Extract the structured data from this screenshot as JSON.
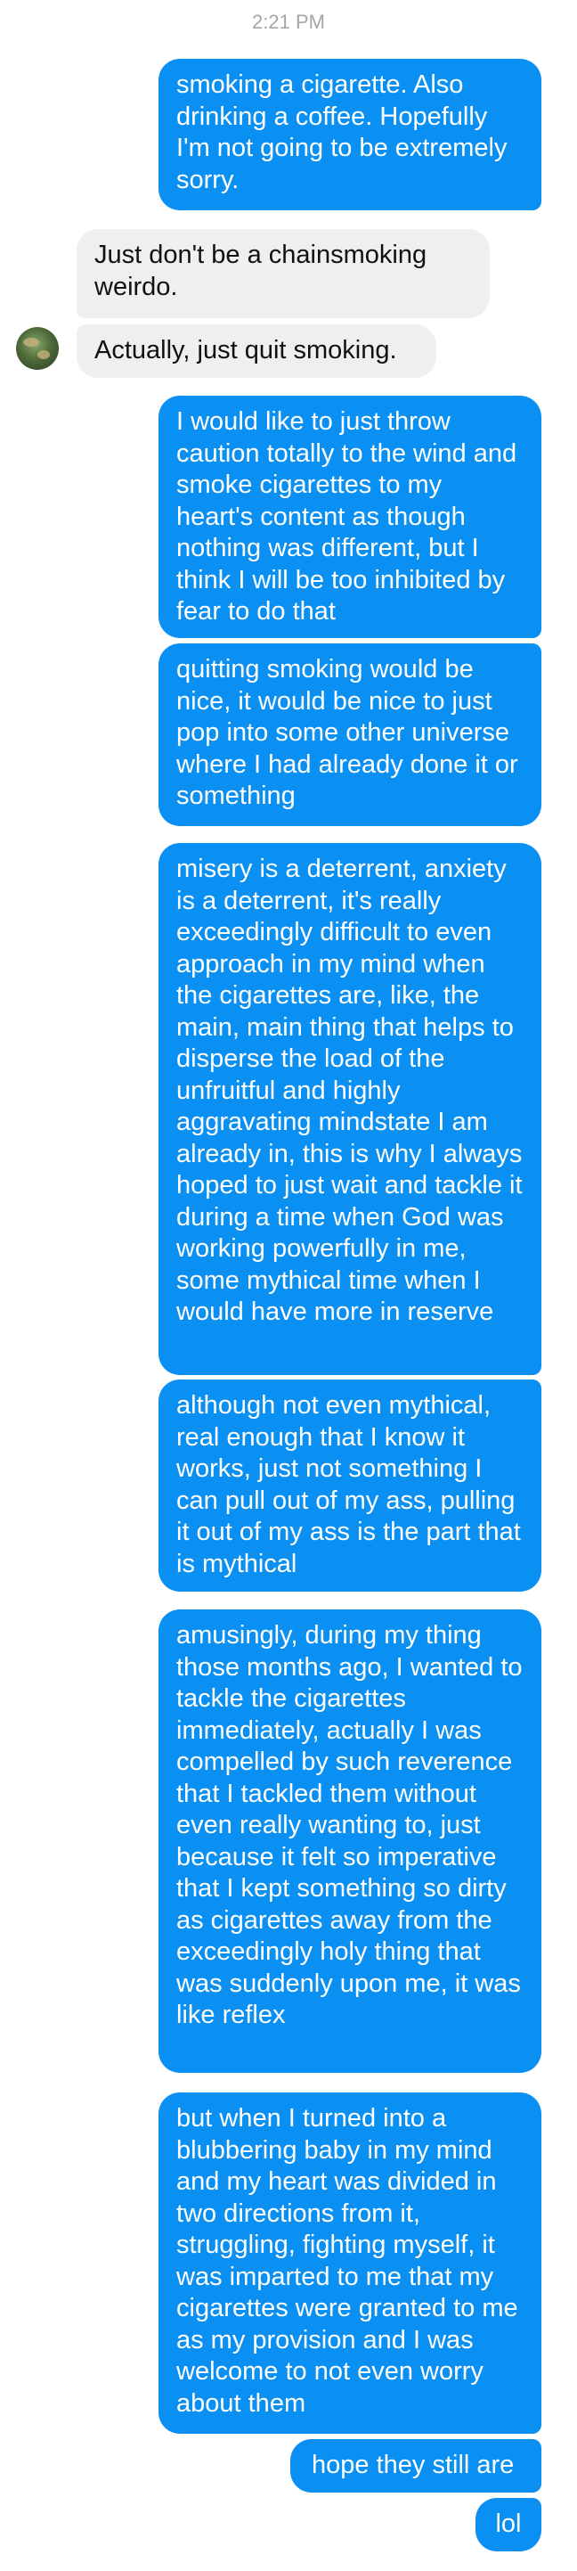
{
  "timestamp": "2:21 PM",
  "messages": [
    {
      "side": "out",
      "text": "smoking a cigarette. Also drinking a coffee. Hopefully I'm not going to be extremely sorry."
    },
    {
      "side": "in",
      "text": "Just don't be a chainsmoking weirdo."
    },
    {
      "side": "in",
      "text": "Actually, just quit smoking."
    },
    {
      "side": "out",
      "text": "I would like to just throw caution totally to the wind and smoke cigarettes to my heart's content as though nothing was different, but I think I will be too inhibited by fear to do that"
    },
    {
      "side": "out",
      "text": "quitting smoking would be nice, it would be nice to just pop into some other universe where I had already done it or something"
    },
    {
      "side": "out",
      "text": "misery is a deterrent, anxiety is a deterrent, it's really exceedingly difficult to even approach in my mind when the cigarettes are, like, the main, main thing that helps to disperse the load of the unfruitful and highly aggravating mindstate I am already in, this is why I always hoped to just wait and tackle it during a time when God was working powerfully in me, some mythical time when I would have more in reserve"
    },
    {
      "side": "out",
      "text": "although not even mythical, real enough that I know it works, just not something I can pull out of my ass, pulling it out of my ass is the part that is mythical"
    },
    {
      "side": "out",
      "text": "amusingly, during my thing those months ago, I wanted to tackle the cigarettes immediately, actually I was compelled by such reverence that I tackled them without even really wanting to, just because it felt so imperative that I kept something so dirty as cigarettes away from the exceedingly holy thing that was suddenly upon me, it was like reflex"
    },
    {
      "side": "out",
      "text": "but when I turned into a blubbering baby in my mind and my heart was divided in two directions from it, struggling, fighting myself, it was imparted to me that my cigarettes were granted to me as my provision and I was welcome to not even worry about them"
    },
    {
      "side": "out",
      "text": "hope they still are"
    },
    {
      "side": "out",
      "text": "lol"
    }
  ]
}
